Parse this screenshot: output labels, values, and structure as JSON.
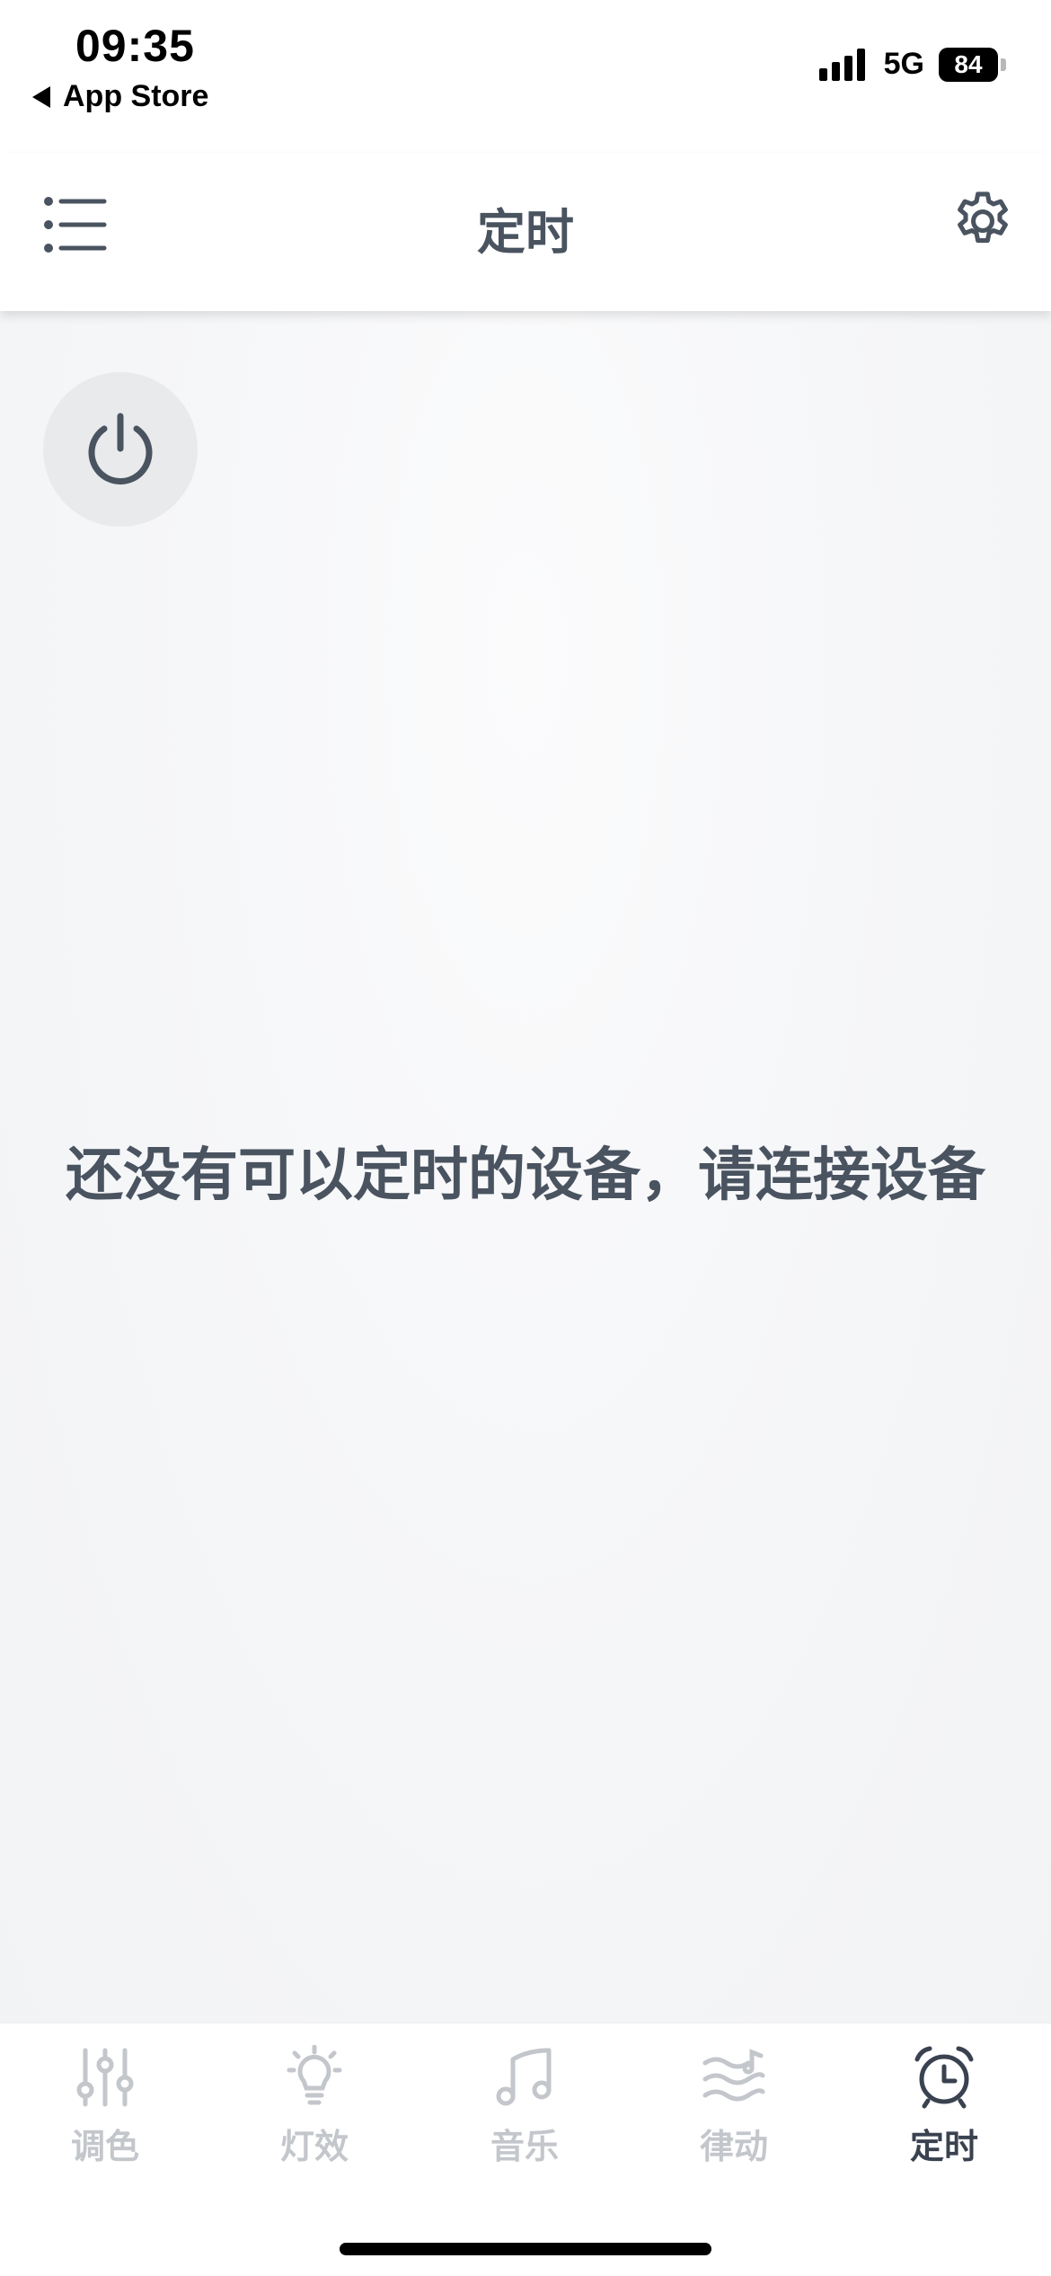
{
  "status_bar": {
    "time": "09:35",
    "back_app": "App Store",
    "network": "5G",
    "battery": "84"
  },
  "header": {
    "title": "定时",
    "menu_icon": "list-menu-icon",
    "settings_icon": "gear-icon"
  },
  "main": {
    "power_icon": "power-icon",
    "empty_message": "还没有可以定时的设备，请连接设备"
  },
  "tabs": [
    {
      "label": "调色",
      "icon": "sliders-icon",
      "active": false
    },
    {
      "label": "灯效",
      "icon": "lightbulb-icon",
      "active": false
    },
    {
      "label": "音乐",
      "icon": "music-note-icon",
      "active": false
    },
    {
      "label": "律动",
      "icon": "rhythm-wave-icon",
      "active": false
    },
    {
      "label": "定时",
      "icon": "alarm-clock-icon",
      "active": true
    }
  ],
  "colors": {
    "text_primary": "#4a5360",
    "tab_inactive": "#c3c6cb",
    "tab_active": "#3a4250",
    "power_button_bg": "#e9eaec"
  }
}
